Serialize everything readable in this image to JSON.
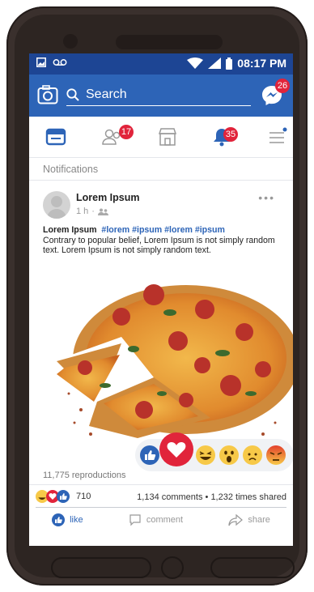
{
  "status_bar": {
    "time": "08:17 PM"
  },
  "header": {
    "search_label": "Search",
    "messenger_badge": "26"
  },
  "tabs": [
    {
      "name": "home",
      "badge": ""
    },
    {
      "name": "friends",
      "badge": "17"
    },
    {
      "name": "marketplace",
      "badge": ""
    },
    {
      "name": "notifications",
      "badge": "35"
    },
    {
      "name": "menu",
      "badge": ""
    }
  ],
  "section_title": "Notifications",
  "post": {
    "author": "Lorem Ipsum",
    "time": "1 h",
    "heading": "Lorem Ipsum",
    "hashtags": "#lorem #ipsum #lorem #ipsum",
    "body": "Contrary to popular belief, Lorem Ipsum is not simply random text. Lorem Ipsum is not simply random text.",
    "views": "11,775 reproductions",
    "reaction_count": "710",
    "comments_shares": "1,134 comments  •  1,232 times shared",
    "actions": {
      "like": "like",
      "comment": "comment",
      "share": "share"
    }
  },
  "colors": {
    "brand": "#2d64b7",
    "status": "#1d4594",
    "badge": "#e1243b"
  }
}
